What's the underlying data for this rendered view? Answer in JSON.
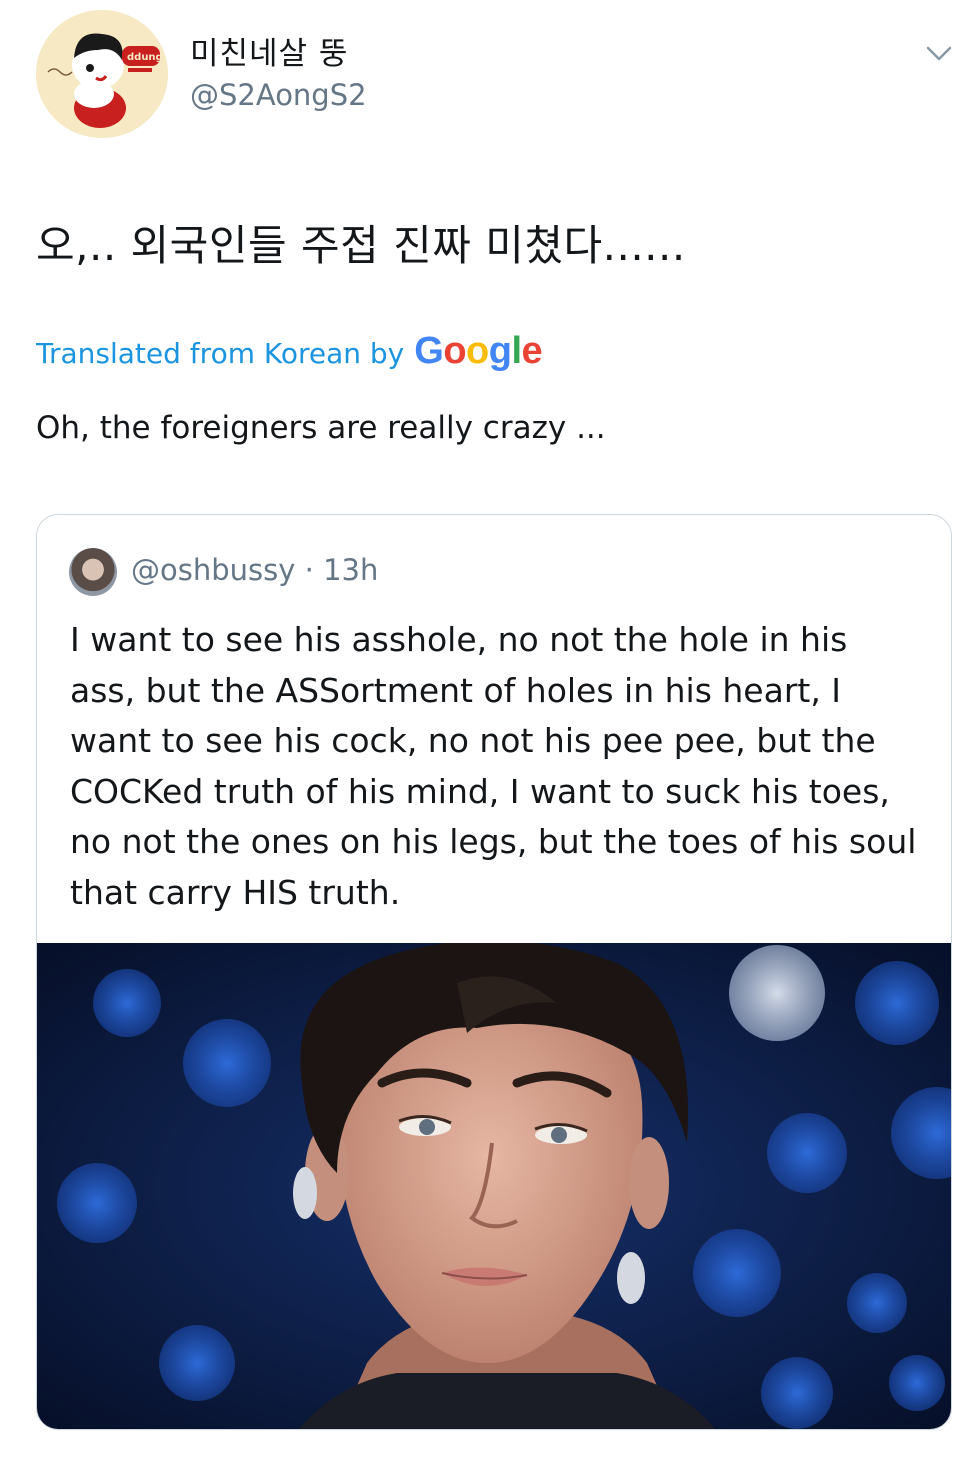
{
  "tweet": {
    "display_name": "미친네살 뚱",
    "handle": "@S2AongS2",
    "avatar_icon": "cartoon-baby-avatar-icon",
    "text": "오,.. 외국인들 주접 진짜 미쳤다......",
    "translated_label": "Translated from Korean by",
    "google_logo": [
      "G",
      "o",
      "o",
      "g",
      "l",
      "e"
    ],
    "translation": "Oh, the foreigners are really crazy ...",
    "menu_icon": "chevron-down-icon"
  },
  "quoted": {
    "handle": "@oshbussy",
    "separator": " · ",
    "time": "13h",
    "text": "I want to see his asshole, no not the hole in his ass, but the ASSortment of holes in his heart, I want to see his cock, no not his pee pee, but the COCKed truth of his mind, I want to suck his toes, no not the ones on his legs, but the toes of his soul that carry HIS truth.",
    "image_icon": "person-photo-icon"
  },
  "colors": {
    "link_blue": "#1b95e0",
    "secondary_text": "#657786",
    "border": "#ccd6dd",
    "photo_bg": "#0a1a3c"
  }
}
